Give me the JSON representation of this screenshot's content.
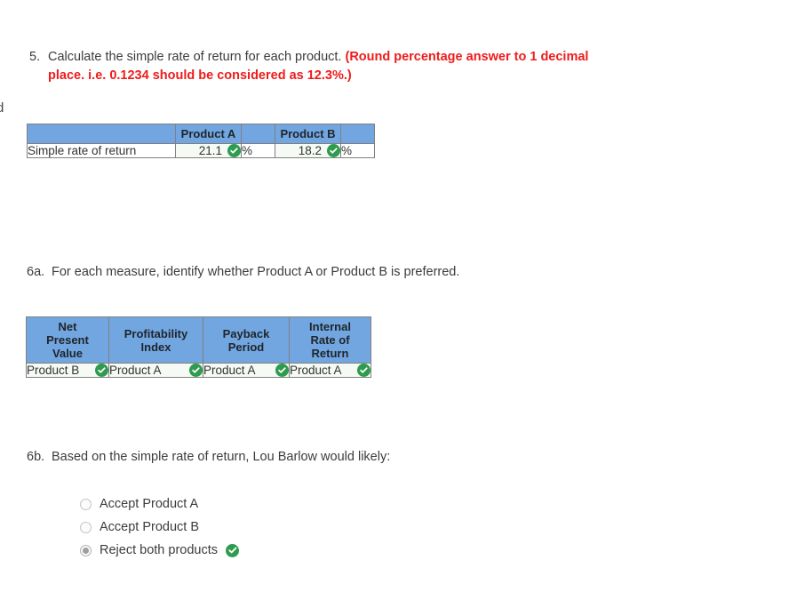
{
  "edge_artifact": "d",
  "questions": {
    "q5": {
      "number": "5.",
      "text": "Calculate the simple rate of return for each product. ",
      "emphasis": "(Round percentage answer to 1 decimal place. i.e. 0.1234 should be considered as 12.3%.)"
    },
    "q6a": {
      "number": "6a.",
      "text": "For each measure, identify whether Product A or Product B is preferred."
    },
    "q6b": {
      "number": "6b.",
      "text": "Based on the simple rate of return, Lou Barlow would likely:"
    }
  },
  "table_simple_rate": {
    "headers": [
      "",
      "Product A",
      "Product B"
    ],
    "row_label": "Simple rate of return",
    "values": [
      "21.1",
      "18.2"
    ],
    "units": [
      "%",
      "%"
    ],
    "status": [
      "correct",
      "correct"
    ]
  },
  "table_preferred": {
    "headers": [
      "Net\nPresent\nValue",
      "Profitability\nIndex",
      "Payback\nPeriod",
      "Internal\nRate of\nReturn"
    ],
    "headers_lines": [
      [
        "Net",
        "Present",
        "Value"
      ],
      [
        "Profitability",
        "Index"
      ],
      [
        "Payback",
        "Period"
      ],
      [
        "Internal",
        "Rate of",
        "Return"
      ]
    ],
    "values": [
      "Product B",
      "Product A",
      "Product A",
      "Product A"
    ],
    "status": [
      "correct",
      "correct",
      "correct",
      "correct"
    ]
  },
  "radio_options": [
    {
      "label": "Accept Product A",
      "selected": false,
      "status": ""
    },
    {
      "label": "Accept Product B",
      "selected": false,
      "status": ""
    },
    {
      "label": "Reject both products",
      "selected": true,
      "status": "correct"
    }
  ],
  "colors": {
    "header_blue": "#72A6E0",
    "answer_cell": "#F5FAF4",
    "correct_green": "#2E9B4E",
    "emphasis_red": "#ef1b1b",
    "border_gray": "#808080",
    "text": "#3c3c3c"
  }
}
